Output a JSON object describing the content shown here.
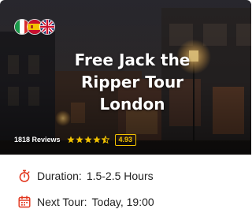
{
  "tour": {
    "title_lines": [
      "Free Jack the",
      "Ripper Tour",
      "London"
    ],
    "reviews": "1818 Reviews",
    "rating": "4.93",
    "stars": 4.5,
    "languages": [
      "Italian",
      "Spanish",
      "English"
    ]
  },
  "details": {
    "duration_label": "Duration:",
    "duration_value": "1.5-2.5 Hours",
    "next_label": "Next Tour:",
    "next_value": "Today, 19:00"
  },
  "colors": {
    "accent": "#e2331a",
    "rating": "#f2c200"
  },
  "icons": {
    "duration": "stopwatch-icon",
    "next_tour": "calendar-icon"
  }
}
